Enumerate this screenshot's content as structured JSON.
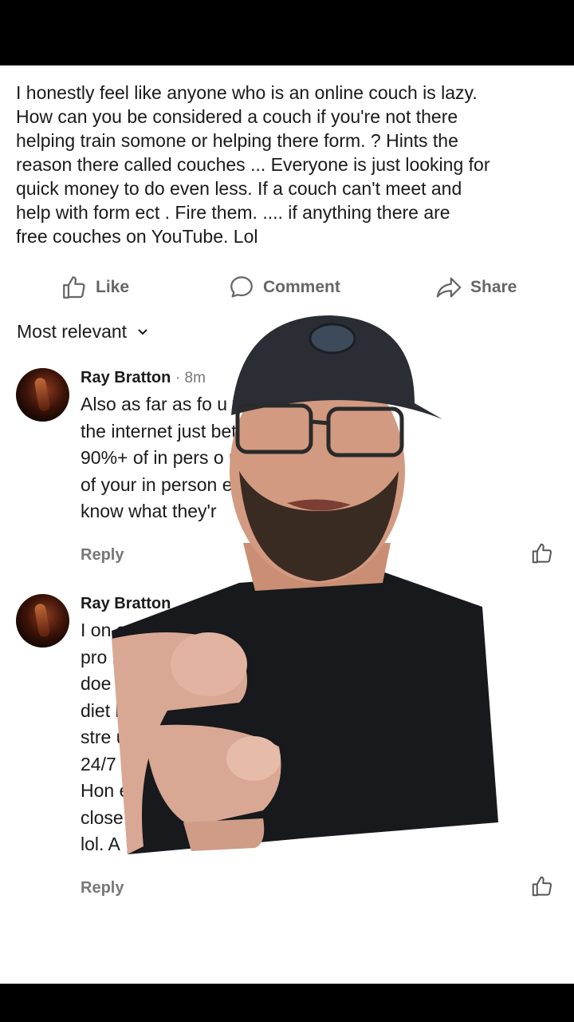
{
  "post": {
    "text": "I honestly feel like anyone who is an online couch is lazy.\nHow can you be considered a couch if you're not there\nhelping train somone or helping there form. ? Hints the\nreason there called couches ... Everyone is just looking for\nquick money to do even less.  If a couch can't meet and\nhelp with form ect .   Fire them.  .... if anything there are\nfree couches on YouTube.  Lol"
  },
  "actions": {
    "like": "Like",
    "comment": "Comment",
    "share": "Share"
  },
  "sort": {
    "label": "Most relevant"
  },
  "comments": [
    {
      "name": "Ray Bratton",
      "time": "· 8m",
      "body": "Also as far as fo                                u form over\nthe internet just                                  better, than\n90%+ of in pers                                  o mention most\nof your in person                               en look like they\nknow what they'r",
      "reply": "Reply"
    },
    {
      "name": "Ray Bratton",
      "time": "",
      "body": "I on                                                       actually\npro                                                        ner\ndoe                                                        ial in\ndiet                                                        life/\nstre                                                        u have\n24/7                                                       case).\nHon                                                        e\nclose                                                      ovides\nlol. A",
      "reply": "Reply"
    }
  ],
  "icons": {
    "like": "thumbs-up-icon",
    "comment": "speech-bubble-icon",
    "share": "share-arrow-icon",
    "sort": "chevron-down-icon"
  },
  "colors": {
    "text": "#1a1a1a",
    "muted": "#666666",
    "bars": "#000000"
  }
}
